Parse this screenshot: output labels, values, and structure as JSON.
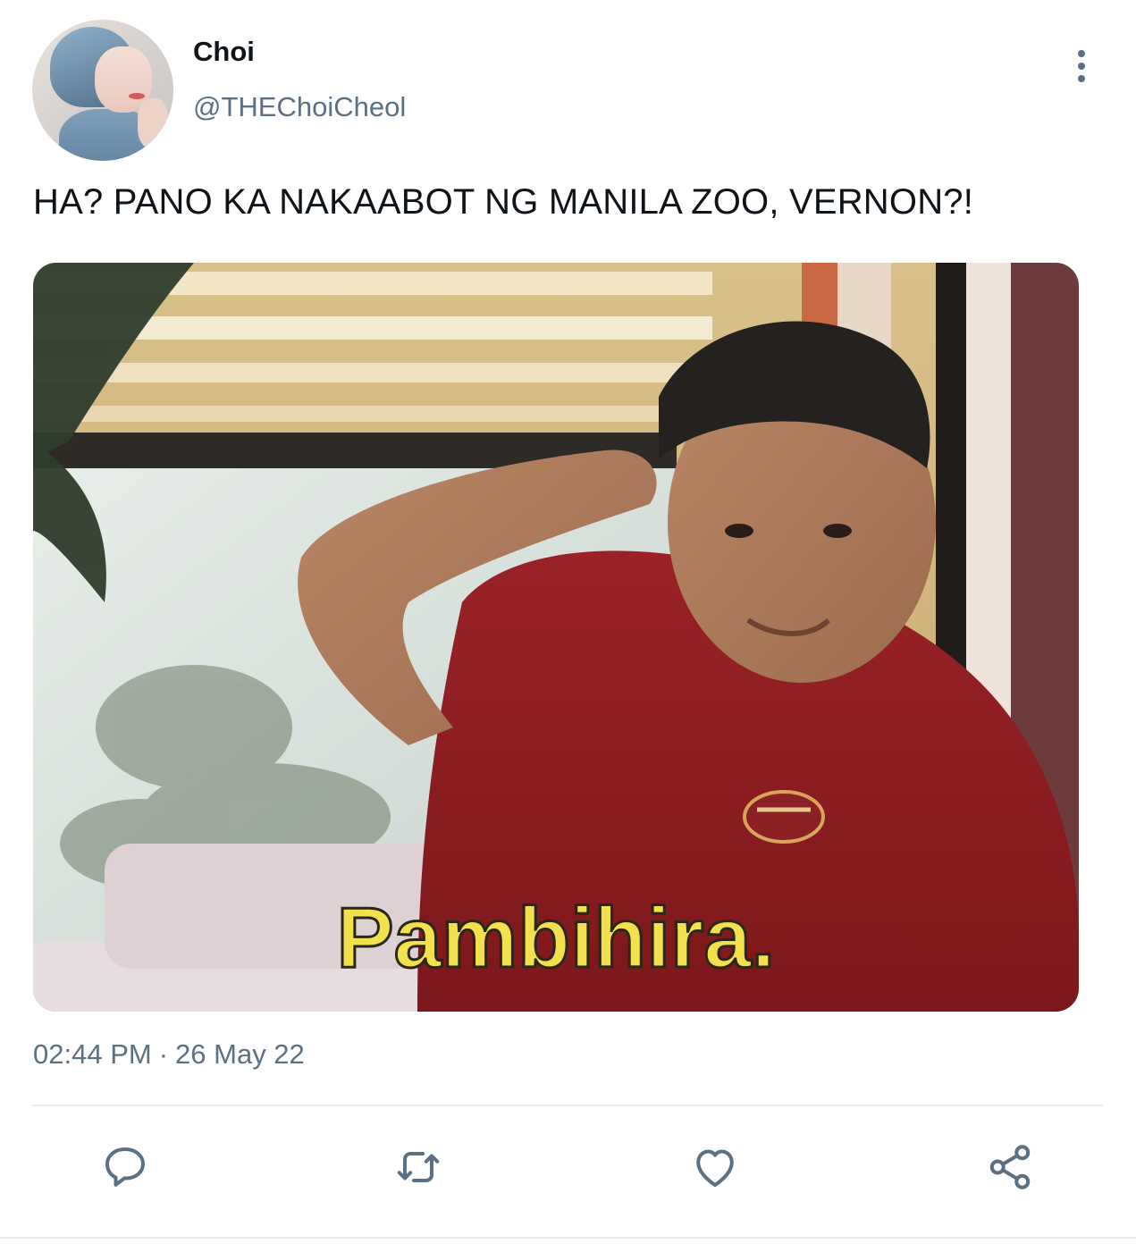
{
  "tweet": {
    "author_name": "Choi",
    "author_handle": "@THEChoiCheol",
    "text": "HA? PANO KA NAKAABOT NG MANILA ZOO, VERNON?!",
    "media_caption": "Pambihira.",
    "time": "02:44 PM",
    "separator": "·",
    "date": "26 May 22"
  },
  "icons": {
    "more": "more-vertical-icon",
    "reply": "reply-icon",
    "retweet": "retweet-icon",
    "like": "heart-icon",
    "share": "share-icon"
  },
  "colors": {
    "text_primary": "#0f1419",
    "text_secondary": "#5b7083",
    "divider": "#e7ebee",
    "caption_fill": "#f2e14c"
  }
}
